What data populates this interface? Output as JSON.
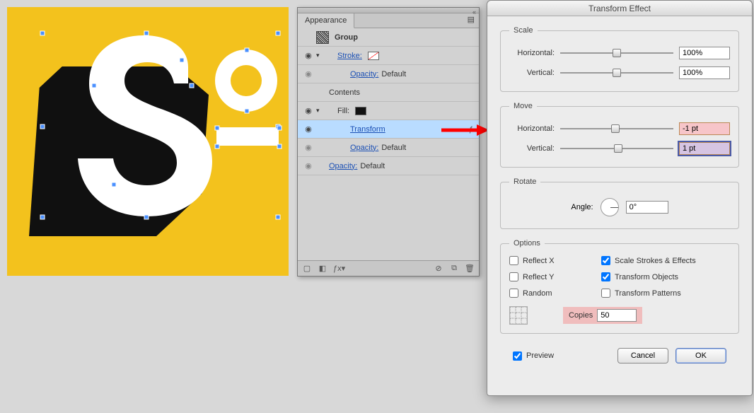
{
  "appearance": {
    "title": "Appearance",
    "group_label": "Group",
    "stroke_label": "Stroke:",
    "opacity_label": "Opacity:",
    "opacity_value": "Default",
    "contents_label": "Contents",
    "fill_label": "Fill:",
    "transform_label": "Transform"
  },
  "dialog": {
    "title": "Transform Effect",
    "scale": {
      "legend": "Scale",
      "horizontal_label": "Horizontal:",
      "horizontal_value": "100%",
      "vertical_label": "Vertical:",
      "vertical_value": "100%"
    },
    "move": {
      "legend": "Move",
      "horizontal_label": "Horizontal:",
      "horizontal_value": "-1 pt",
      "vertical_label": "Vertical:",
      "vertical_value": "1 pt"
    },
    "rotate": {
      "legend": "Rotate",
      "angle_label": "Angle:",
      "angle_value": "0°"
    },
    "options": {
      "legend": "Options",
      "reflect_x": "Reflect X",
      "reflect_y": "Reflect Y",
      "random": "Random",
      "scale_strokes": "Scale Strokes & Effects",
      "transform_objects": "Transform Objects",
      "transform_patterns": "Transform Patterns",
      "copies_label": "Copies",
      "copies_value": "50"
    },
    "footer": {
      "preview": "Preview",
      "cancel": "Cancel",
      "ok": "OK"
    }
  }
}
